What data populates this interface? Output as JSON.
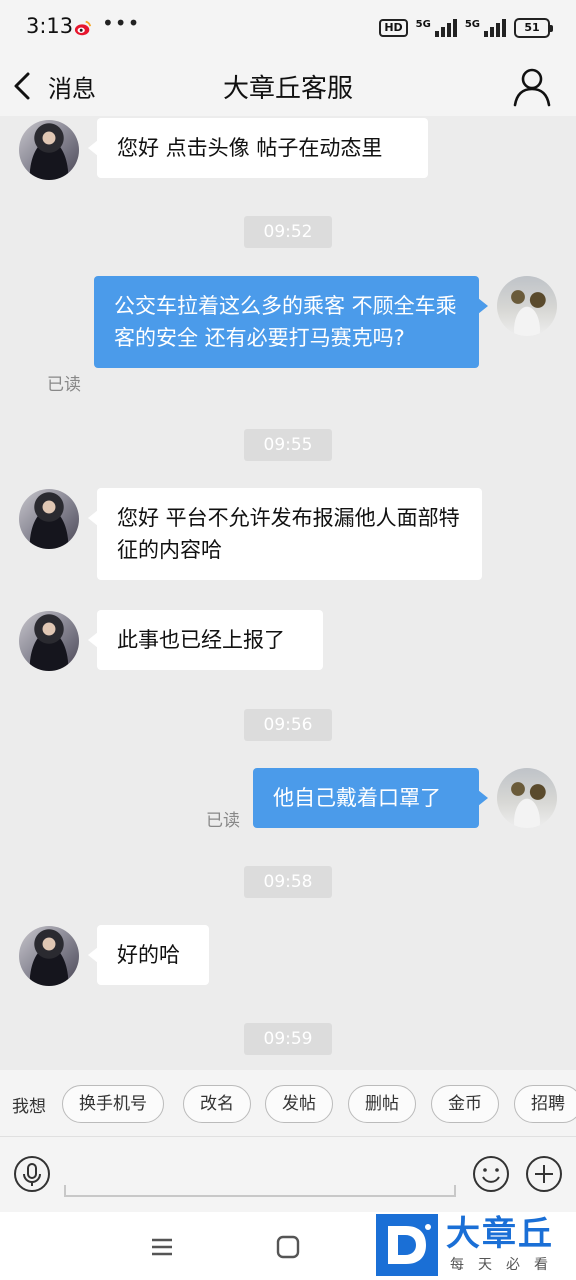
{
  "status_bar": {
    "time": "3:13",
    "icons": [
      "weibo-icon",
      "more-dots-icon",
      "hd-icon",
      "signal-5g-icon",
      "battery-icon"
    ],
    "hd": "HD",
    "net1": "5G",
    "net2": "5G",
    "battery": "51"
  },
  "nav": {
    "back_label": "消息",
    "title": "大章丘客服",
    "back_icon": "chevron-left-icon",
    "profile_icon": "person-icon"
  },
  "messages": [
    {
      "type": "in",
      "text": "您好 点击头像 帖子在动态里"
    },
    {
      "type": "time",
      "text": "09:52"
    },
    {
      "type": "out",
      "text": "公交车拉着这么多的乘客 不顾全车乘客的安全 还有必要打马赛克吗?",
      "read": "已读"
    },
    {
      "type": "time",
      "text": "09:55"
    },
    {
      "type": "in",
      "text": "您好 平台不允许发布报漏他人面部特征的内容哈"
    },
    {
      "type": "in",
      "text": "此事也已经上报了"
    },
    {
      "type": "time",
      "text": "09:56"
    },
    {
      "type": "out",
      "text": "他自己戴着口罩了",
      "read": "已读"
    },
    {
      "type": "time",
      "text": "09:58"
    },
    {
      "type": "in",
      "text": "好的哈"
    },
    {
      "type": "time",
      "text": "09:59"
    }
  ],
  "quick_replies": {
    "label": "我想",
    "items": [
      "换手机号",
      "改名",
      "发帖",
      "删帖",
      "金币",
      "招聘"
    ]
  },
  "input": {
    "placeholder": "",
    "voice_icon": "microphone-icon",
    "emoji_icon": "emoji-icon",
    "plus_icon": "plus-icon"
  },
  "system_nav": {
    "menu_icon": "menu-icon",
    "home_icon": "home-icon"
  },
  "watermark": {
    "brand": "大章丘",
    "tagline": "每天必看",
    "color": "#1a6fd6"
  },
  "colors": {
    "outgoing_bubble": "#4b9bea",
    "incoming_bubble": "#ffffff",
    "background": "#ececec"
  }
}
